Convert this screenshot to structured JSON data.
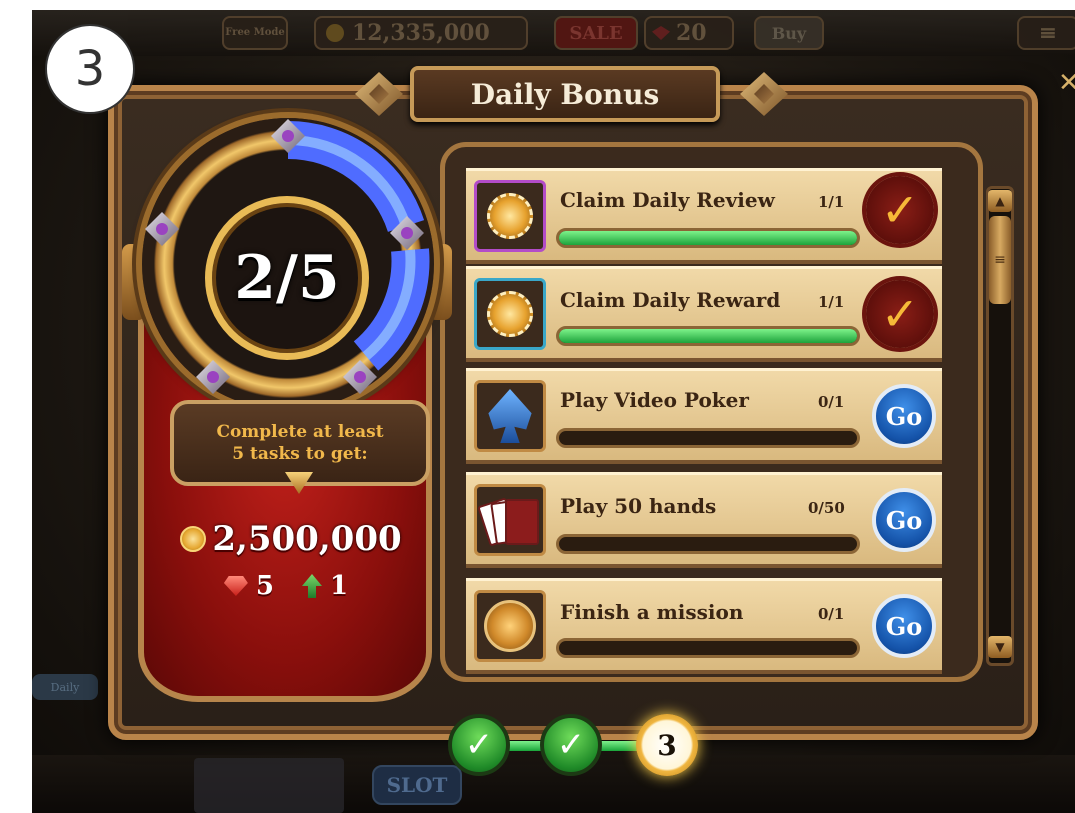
{
  "tutorial_step": "3",
  "top_bar": {
    "free_mode_label": "Free Mode",
    "coin_balance": "12,335,000",
    "sale_label": "SALE",
    "gem_balance": "20",
    "buy_label": "Buy"
  },
  "bottom_bar": {
    "slot_label": "SLOT",
    "daily_tab_label": "Daily"
  },
  "dialog": {
    "title": "Daily Bonus",
    "progress_text": "2/5",
    "requirement_line1": "Complete at least",
    "requirement_line2": "5 tasks to get:",
    "reward_coins": "2,500,000",
    "reward_gems": "5",
    "reward_level_boost": "1",
    "tasks": [
      {
        "label": "Claim Daily Review",
        "count": "1/1",
        "progress": 1.0,
        "status": "done",
        "icon": "review-chip-icon"
      },
      {
        "label": "Claim Daily Reward",
        "count": "1/1",
        "progress": 1.0,
        "status": "done",
        "icon": "reward-chip-icon"
      },
      {
        "label": "Play Video Poker",
        "count": "0/1",
        "progress": 0.0,
        "status": "go",
        "icon": "spade-icon",
        "action_label": "Go"
      },
      {
        "label": "Play 50 hands",
        "count": "0/50",
        "progress": 0.0,
        "status": "go",
        "icon": "cards-icon",
        "action_label": "Go"
      },
      {
        "label": "Finish a mission",
        "count": "0/1",
        "progress": 0.0,
        "status": "go",
        "icon": "crown-icon",
        "action_label": "Go"
      }
    ],
    "steps": {
      "current_step_label": "3"
    }
  },
  "colors": {
    "progress_green": "#1da33c",
    "go_blue": "#1452a8",
    "seal_red": "#5e0f0b",
    "reward_panel_red": "#8a0f0c",
    "banner_text": "#f1b84b"
  }
}
